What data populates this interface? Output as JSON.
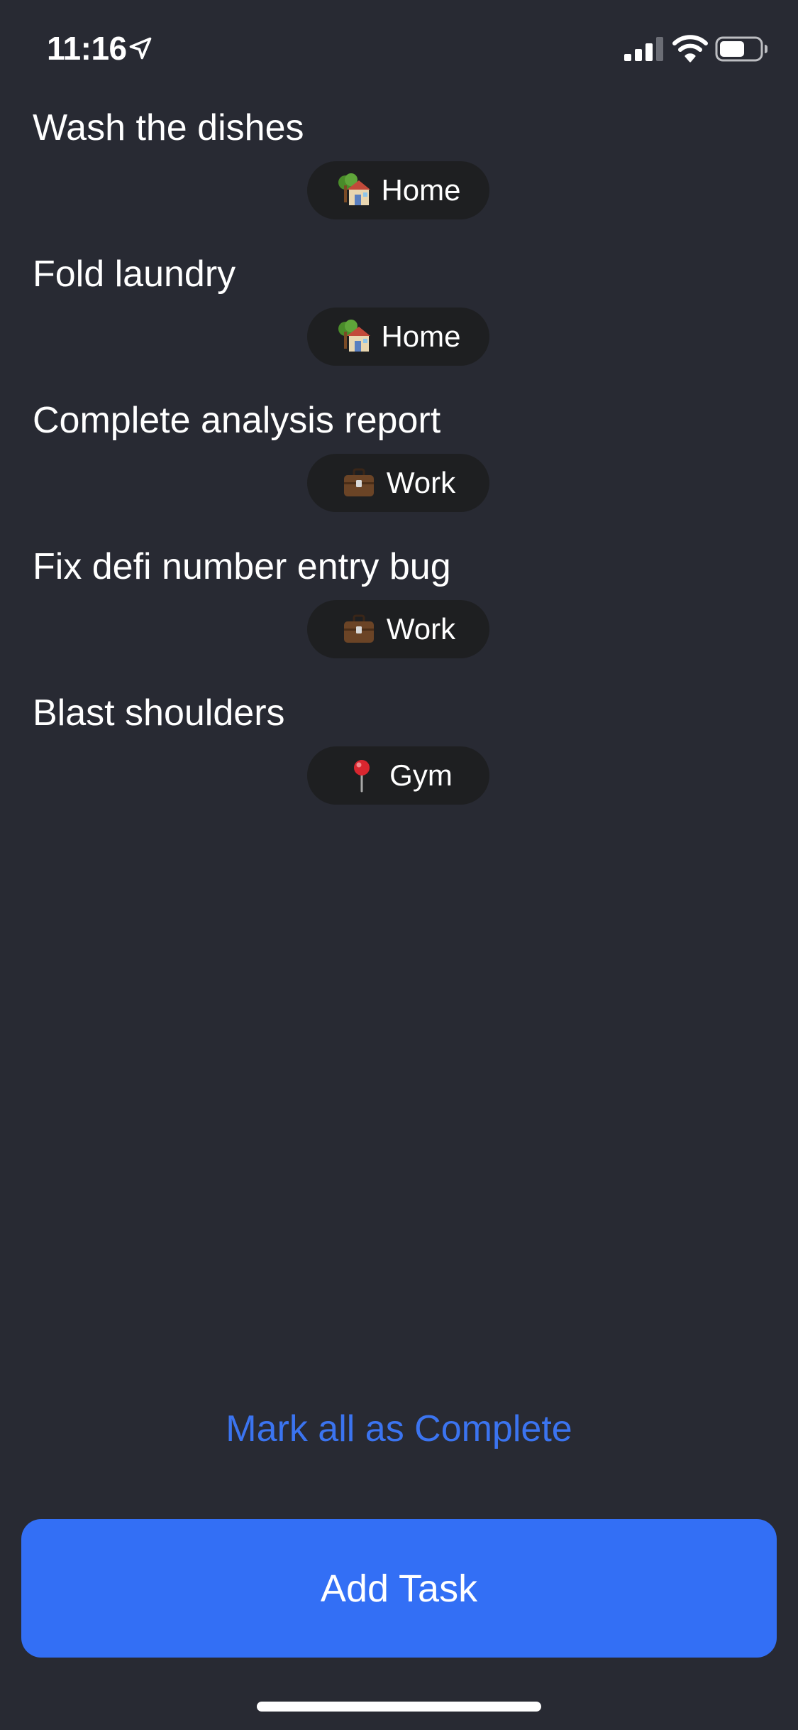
{
  "status_bar": {
    "time": "11:16",
    "icons": [
      "location-arrow-icon",
      "signal-icon",
      "wifi-icon",
      "battery-icon"
    ]
  },
  "tasks": [
    {
      "title": "Wash the dishes",
      "tag": {
        "label": "Home",
        "icon": "house-icon"
      }
    },
    {
      "title": "Fold laundry",
      "tag": {
        "label": "Home",
        "icon": "house-icon"
      }
    },
    {
      "title": "Complete analysis report",
      "tag": {
        "label": "Work",
        "icon": "briefcase-icon"
      }
    },
    {
      "title": "Fix defi number entry bug",
      "tag": {
        "label": "Work",
        "icon": "briefcase-icon"
      }
    },
    {
      "title": "Blast shoulders",
      "tag": {
        "label": "Gym",
        "icon": "pin-icon"
      }
    }
  ],
  "actions": {
    "mark_all_label": "Mark all as Complete",
    "add_task_label": "Add Task"
  },
  "colors": {
    "background": "#282a33",
    "tag_background": "#1e1f21",
    "accent_link": "#3b74f0",
    "primary_button": "#336ff5"
  }
}
